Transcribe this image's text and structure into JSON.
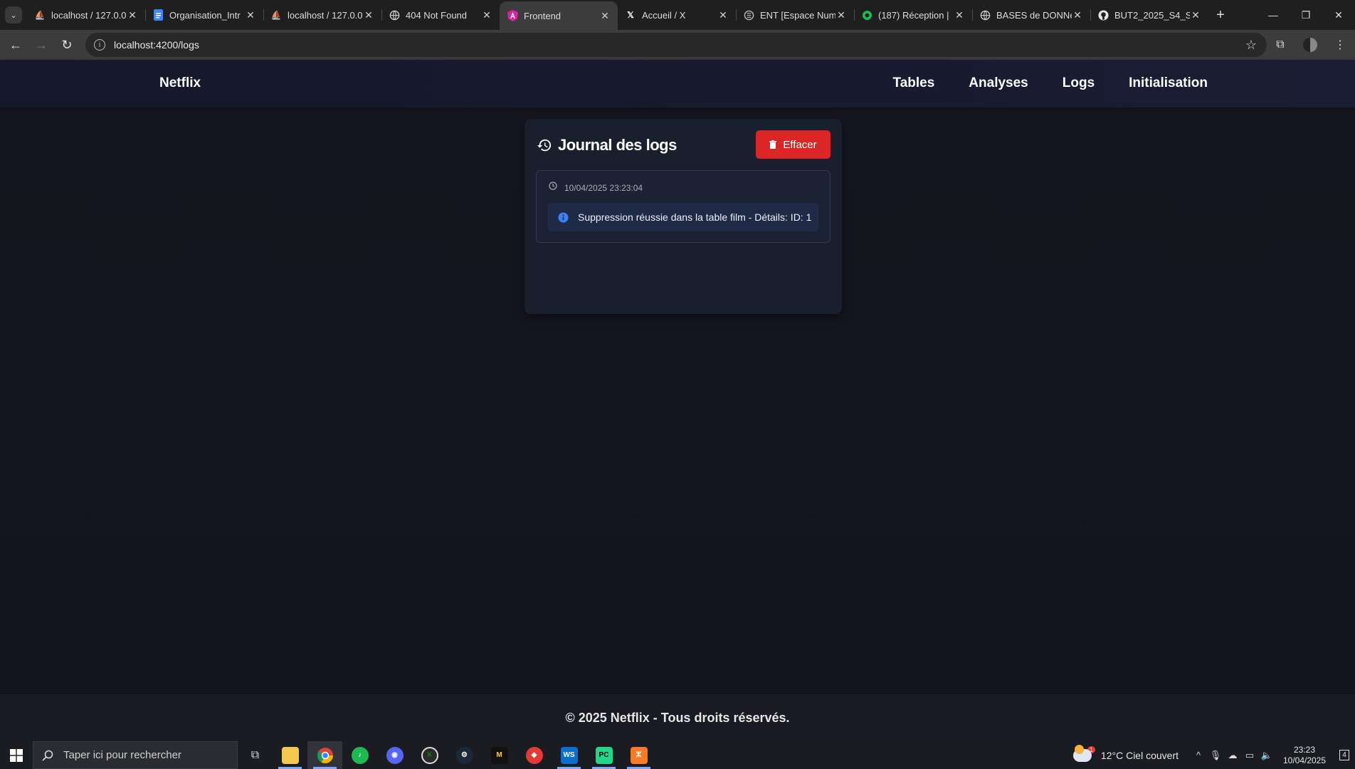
{
  "browser": {
    "tabs": [
      {
        "title": "localhost / 127.0.0",
        "icon": "phpmyadmin-icon",
        "active": false
      },
      {
        "title": "Organisation_Intr",
        "icon": "google-docs-icon",
        "active": false
      },
      {
        "title": "localhost / 127.0.0",
        "icon": "phpmyadmin-icon",
        "active": false
      },
      {
        "title": "404 Not Found",
        "icon": "globe-icon",
        "active": false
      },
      {
        "title": "Frontend",
        "icon": "angular-icon",
        "active": true
      },
      {
        "title": "Accueil / X",
        "icon": "x-logo-icon",
        "active": false
      },
      {
        "title": "ENT [Espace Num",
        "icon": "ent-icon",
        "active": false
      },
      {
        "title": "(187) Réception |",
        "icon": "mail-icon",
        "active": false
      },
      {
        "title": "BASES de DONNé",
        "icon": "globe-icon",
        "active": false
      },
      {
        "title": "BUT2_2025_S4_SA",
        "icon": "github-icon",
        "active": false
      }
    ],
    "url": "localhost:4200/logs"
  },
  "navbar": {
    "brand": "Netflix",
    "links": [
      "Tables",
      "Analyses",
      "Logs",
      "Initialisation"
    ]
  },
  "logs": {
    "title": "Journal des logs",
    "clear_label": "Effacer",
    "entries": [
      {
        "timestamp": "10/04/2025 23:23:04",
        "message": "Suppression réussie dans la table film - Détails: ID: 1"
      }
    ]
  },
  "footer": {
    "text": "© 2025 Netflix - Tous droits réservés."
  },
  "taskbar": {
    "search_placeholder": "Taper ici pour rechercher",
    "weather": "12°C  Ciel couvert",
    "weather_badge": "1",
    "time": "23:23",
    "date": "10/04/2025",
    "notifications": "4"
  },
  "colors": {
    "accent_red": "#dc2626",
    "info_blue": "#3b82f6",
    "card_bg": "#1a1f2e"
  }
}
